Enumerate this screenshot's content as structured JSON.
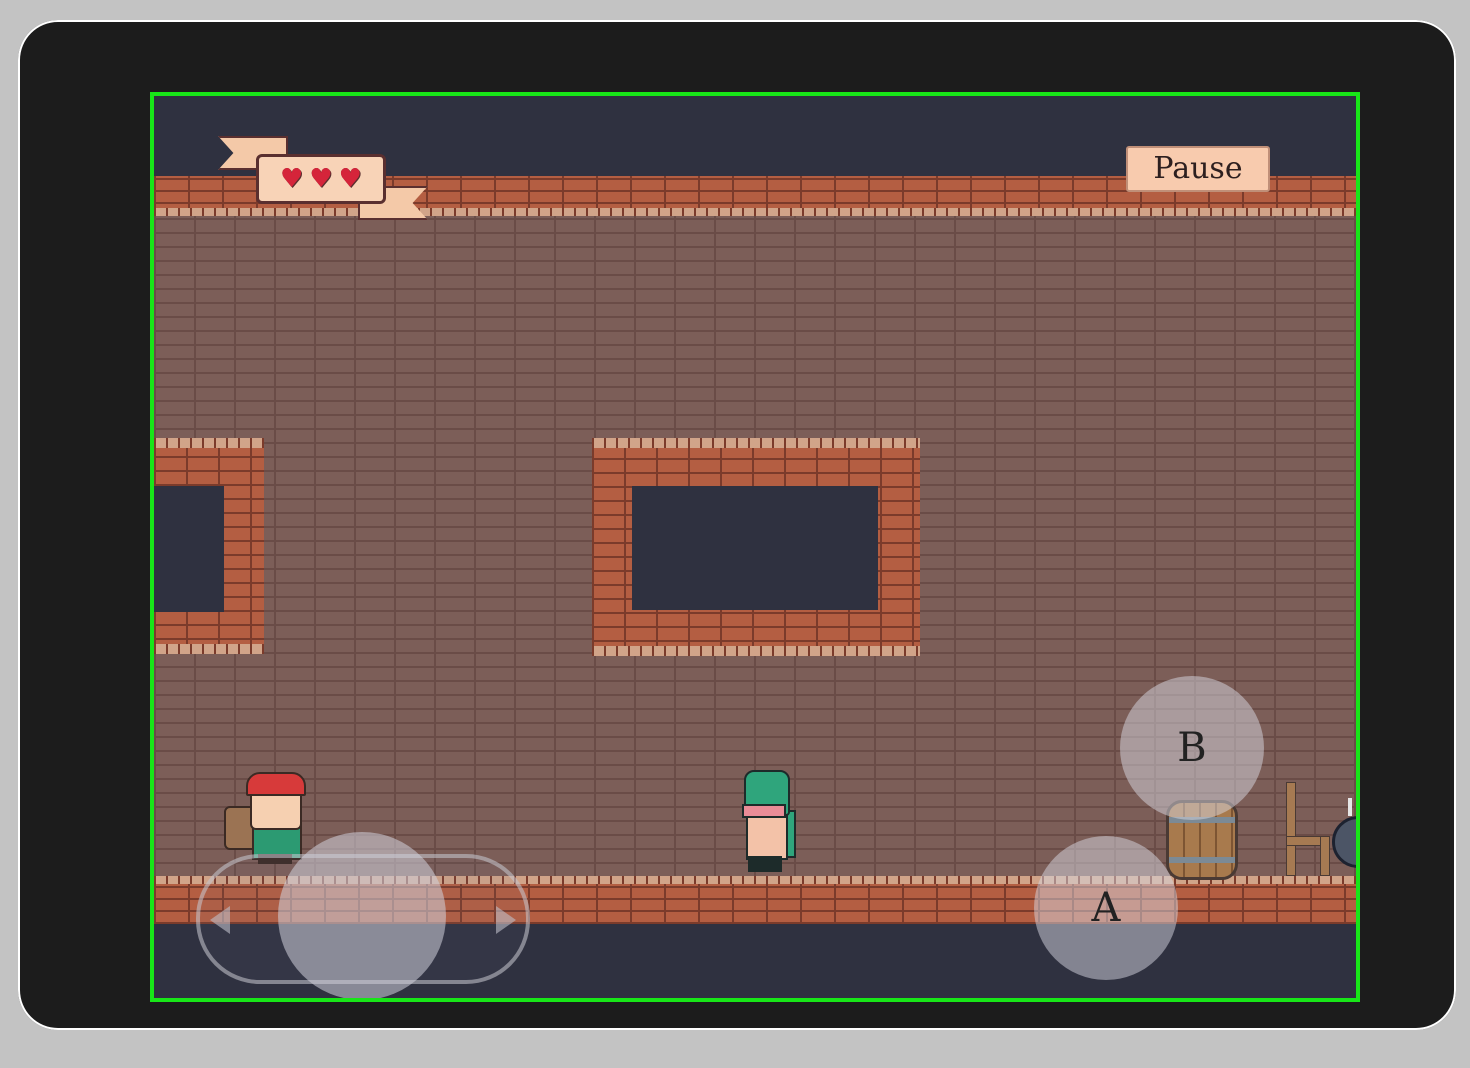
{
  "hud": {
    "hearts": [
      "♥",
      "♥",
      "♥"
    ],
    "pause_label": "Pause"
  },
  "controls": {
    "a_label": "A",
    "b_label": "B"
  },
  "colors": {
    "screen_border": "#18e618",
    "brick": "#b45e42",
    "heart": "#d5243a"
  },
  "icons": {
    "left": "left-arrow-icon",
    "right": "right-arrow-icon"
  }
}
